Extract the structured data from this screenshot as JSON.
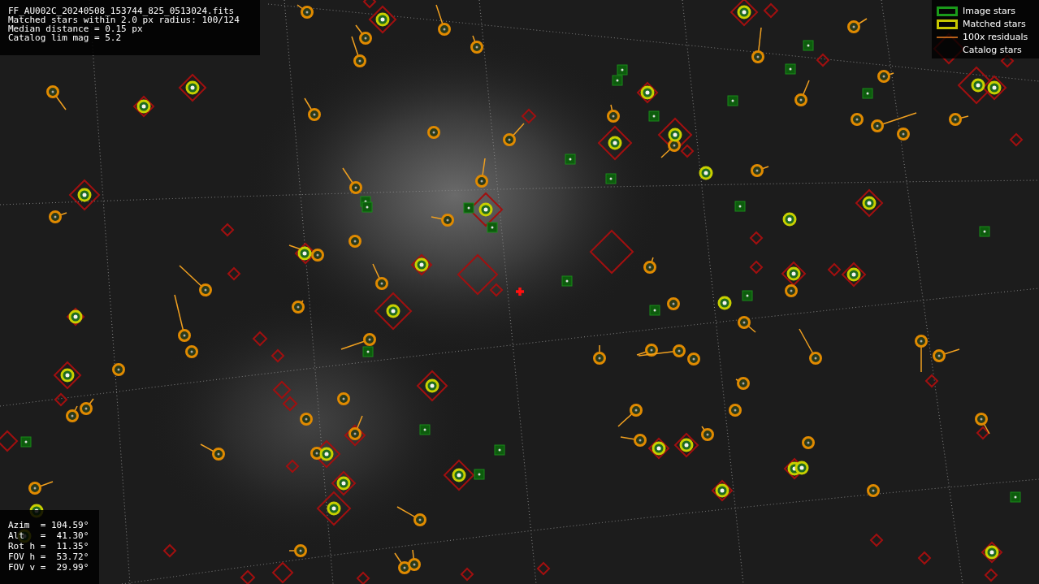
{
  "info_box": {
    "lines": [
      "FF_AU002C_20240508_153744_825_0513024.fits",
      "Matched stars within 2.0 px radius: 100/124",
      "Median distance = 0.15 px",
      "Catalog lim mag = 5.2"
    ]
  },
  "legend": {
    "items": [
      {
        "label": "Image stars",
        "kind": "image"
      },
      {
        "label": "Matched stars",
        "kind": "matched"
      },
      {
        "label": "100x residuals",
        "kind": "residual"
      },
      {
        "label": "Catalog stars",
        "kind": "catalog"
      }
    ]
  },
  "pointing_box": {
    "lines": [
      "Azim  = 104.59°",
      "Alt   =  41.30°",
      "Rot h =  11.35°",
      "FOV h =  53.72°",
      "FOV v =  29.99°"
    ]
  }
}
